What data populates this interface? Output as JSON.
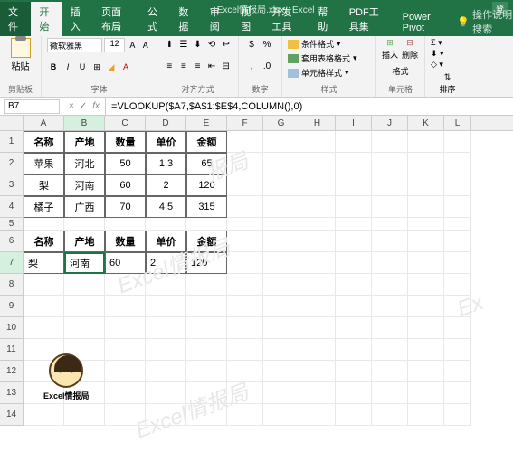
{
  "titlebar": {
    "title": "Excel情报局.xlsx - Excel",
    "login": "登"
  },
  "tabs": {
    "file": "文件",
    "home": "开始",
    "insert": "插入",
    "layout": "页面布局",
    "formulas": "公式",
    "data": "数据",
    "review": "审阅",
    "view": "视图",
    "dev": "开发工具",
    "help": "帮助",
    "pdf": "PDF工具集",
    "power": "Power Pivot",
    "tell": "操作说明搜索"
  },
  "ribbon": {
    "paste": "粘贴",
    "clipboard": "剪贴板",
    "font_name": "微软雅黑",
    "font_size": "12",
    "font_group": "字体",
    "align_group": "对齐方式",
    "num_group": "数字",
    "cond_fmt": "条件格式",
    "table_fmt": "套用表格格式",
    "cell_styles": "单元格样式",
    "styles_group": "样式",
    "insert": "插入",
    "delete": "删除",
    "format": "格式",
    "cells_group": "单元格",
    "sort": "排序",
    "edit_group": "编"
  },
  "namebox": "B7",
  "formula": "=VLOOKUP($A7,$A$1:$E$4,COLUMN(),0)",
  "cols": [
    "A",
    "B",
    "C",
    "D",
    "E",
    "F",
    "G",
    "H",
    "I",
    "J",
    "K",
    "L"
  ],
  "table1": {
    "headers": [
      "名称",
      "产地",
      "数量",
      "单价",
      "金额"
    ],
    "rows": [
      [
        "苹果",
        "河北",
        "50",
        "1.3",
        "65"
      ],
      [
        "梨",
        "河南",
        "60",
        "2",
        "120"
      ],
      [
        "橘子",
        "广西",
        "70",
        "4.5",
        "315"
      ]
    ]
  },
  "table2": {
    "headers": [
      "名称",
      "产地",
      "数量",
      "单价",
      "金额"
    ],
    "rows": [
      [
        "梨",
        "河南",
        "60",
        "2",
        "120"
      ]
    ]
  },
  "avatar_label": "Excel情报局",
  "watermarks": [
    "报局",
    "Excel情报局",
    "Ex"
  ]
}
